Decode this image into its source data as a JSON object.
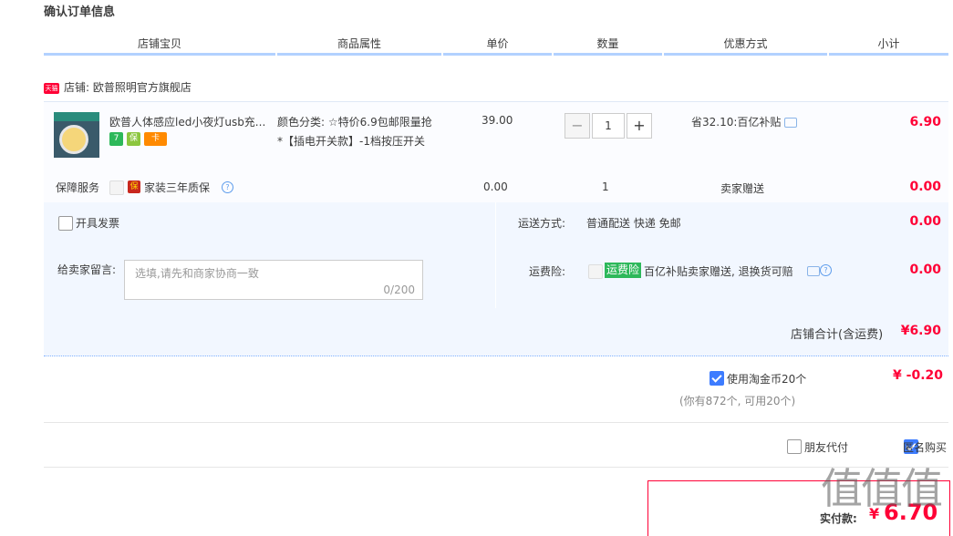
{
  "page": {
    "title": "确认订单信息"
  },
  "columns": [
    "店铺宝贝",
    "商品属性",
    "单价",
    "数量",
    "优惠方式",
    "小计"
  ],
  "shop": {
    "tmall_badge": "天猫",
    "label": "店铺: 欧普照明官方旗舰店"
  },
  "item": {
    "name": "欧普人体感应led小夜灯usb充...",
    "attr_line1": "颜色分类: ☆特价6.9包邮限量抢",
    "attr_line2": "*【插电开关款】-1档按压开关",
    "price": "39.00",
    "quantity": "1",
    "minus": "−",
    "plus": "+",
    "discount": "省32.10:百亿补贴",
    "subtotal": "6.90",
    "badges": [
      "7",
      "保",
      "卡"
    ]
  },
  "service": {
    "label": "保障服务",
    "badge": "保",
    "name": "家装三年质保",
    "help": "?",
    "price": "0.00",
    "qty": "1",
    "discount": "卖家赠送",
    "subtotal": "0.00"
  },
  "invoice": {
    "label": "开具发票"
  },
  "shipping": {
    "label": "运送方式:",
    "value": "普通配送 快递 免邮",
    "amount": "0.00"
  },
  "message": {
    "label": "给卖家留言:",
    "placeholder": "选填,请先和商家协商一致",
    "counter": "0/200"
  },
  "insurance": {
    "label": "运费险:",
    "badge": "运费险",
    "text": "百亿补贴卖家赠送, 退换货可赔",
    "help": "?",
    "amount": "0.00"
  },
  "shop_total": {
    "label": "店铺合计(含运费)",
    "amount": "¥6.90"
  },
  "coins": {
    "label": "使用淘金币20个",
    "note": "(你有872个, 可用20个)",
    "amount": "¥ -0.20"
  },
  "options": {
    "friend_pay": "朋友代付",
    "anonymous": "匿名购买"
  },
  "payment": {
    "label": "实付款:",
    "currency": "¥",
    "amount": "6.70"
  },
  "watermark": {
    "text": "值值值"
  },
  "colors": {
    "accent": "#ff0036",
    "header_line": "#b2d1ff",
    "row_bg": "#f2f7ff",
    "checkbox": "#3d7cff"
  }
}
